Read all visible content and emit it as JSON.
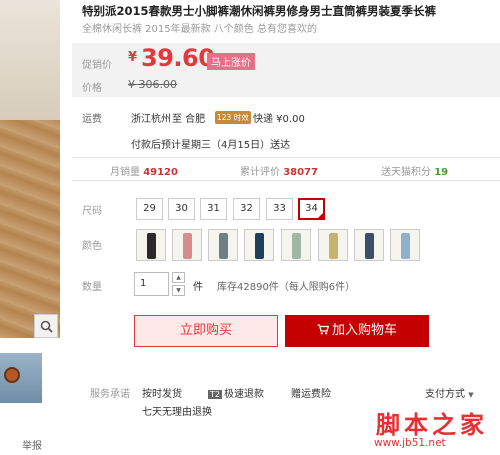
{
  "product": {
    "title": "特别派2015春款男士小脚裤潮休闲裤男修身男士直筒裤男装夏季长裤",
    "subtitle": "全棉休闲长裤 2015年最新款 八个颜色 总有您喜欢的"
  },
  "price": {
    "promo_label": "促销价",
    "currency": "¥",
    "value": "39.60",
    "badge": "马上涨价",
    "orig_label": "价格",
    "orig_value": "¥ 306.00"
  },
  "shipping": {
    "label": "运费",
    "from": "浙江杭州",
    "to": "至 合肥",
    "tag": "123 时效",
    "express": "快递 ¥0.00",
    "eta": "付款后预计星期三（4月15日）送达"
  },
  "stats": {
    "monthly_label": "月销量",
    "monthly_value": "49120",
    "reviews_label": "累计评价",
    "reviews_value": "38077",
    "points_label": "送天猫积分",
    "points_value": "19"
  },
  "size": {
    "label": "尺码",
    "options": [
      "29",
      "30",
      "31",
      "32",
      "33",
      "34"
    ],
    "selected": "34"
  },
  "color": {
    "label": "颜色",
    "swatches": [
      "#2a2a2a",
      "#d98c8c",
      "#6e7f86",
      "#1f3f5a",
      "#9fb8a6",
      "#c8b36a",
      "#3d4e6a",
      "#8fb0c8"
    ]
  },
  "quantity": {
    "label": "数量",
    "value": "1",
    "unit": "件",
    "stock": "库存42890件（每人限购6件）"
  },
  "actions": {
    "buy_now": "立即购买",
    "add_cart": "加入购物车"
  },
  "services": {
    "label": "服务承诺",
    "items": [
      "按时发货",
      "极速退款",
      "赠运费险",
      "七天无理由退换"
    ],
    "t2": "T2",
    "pay": "支付方式"
  },
  "misc": {
    "report": "举报",
    "watermark": "脚本之家",
    "watermark_url": "www.jb51.net"
  }
}
